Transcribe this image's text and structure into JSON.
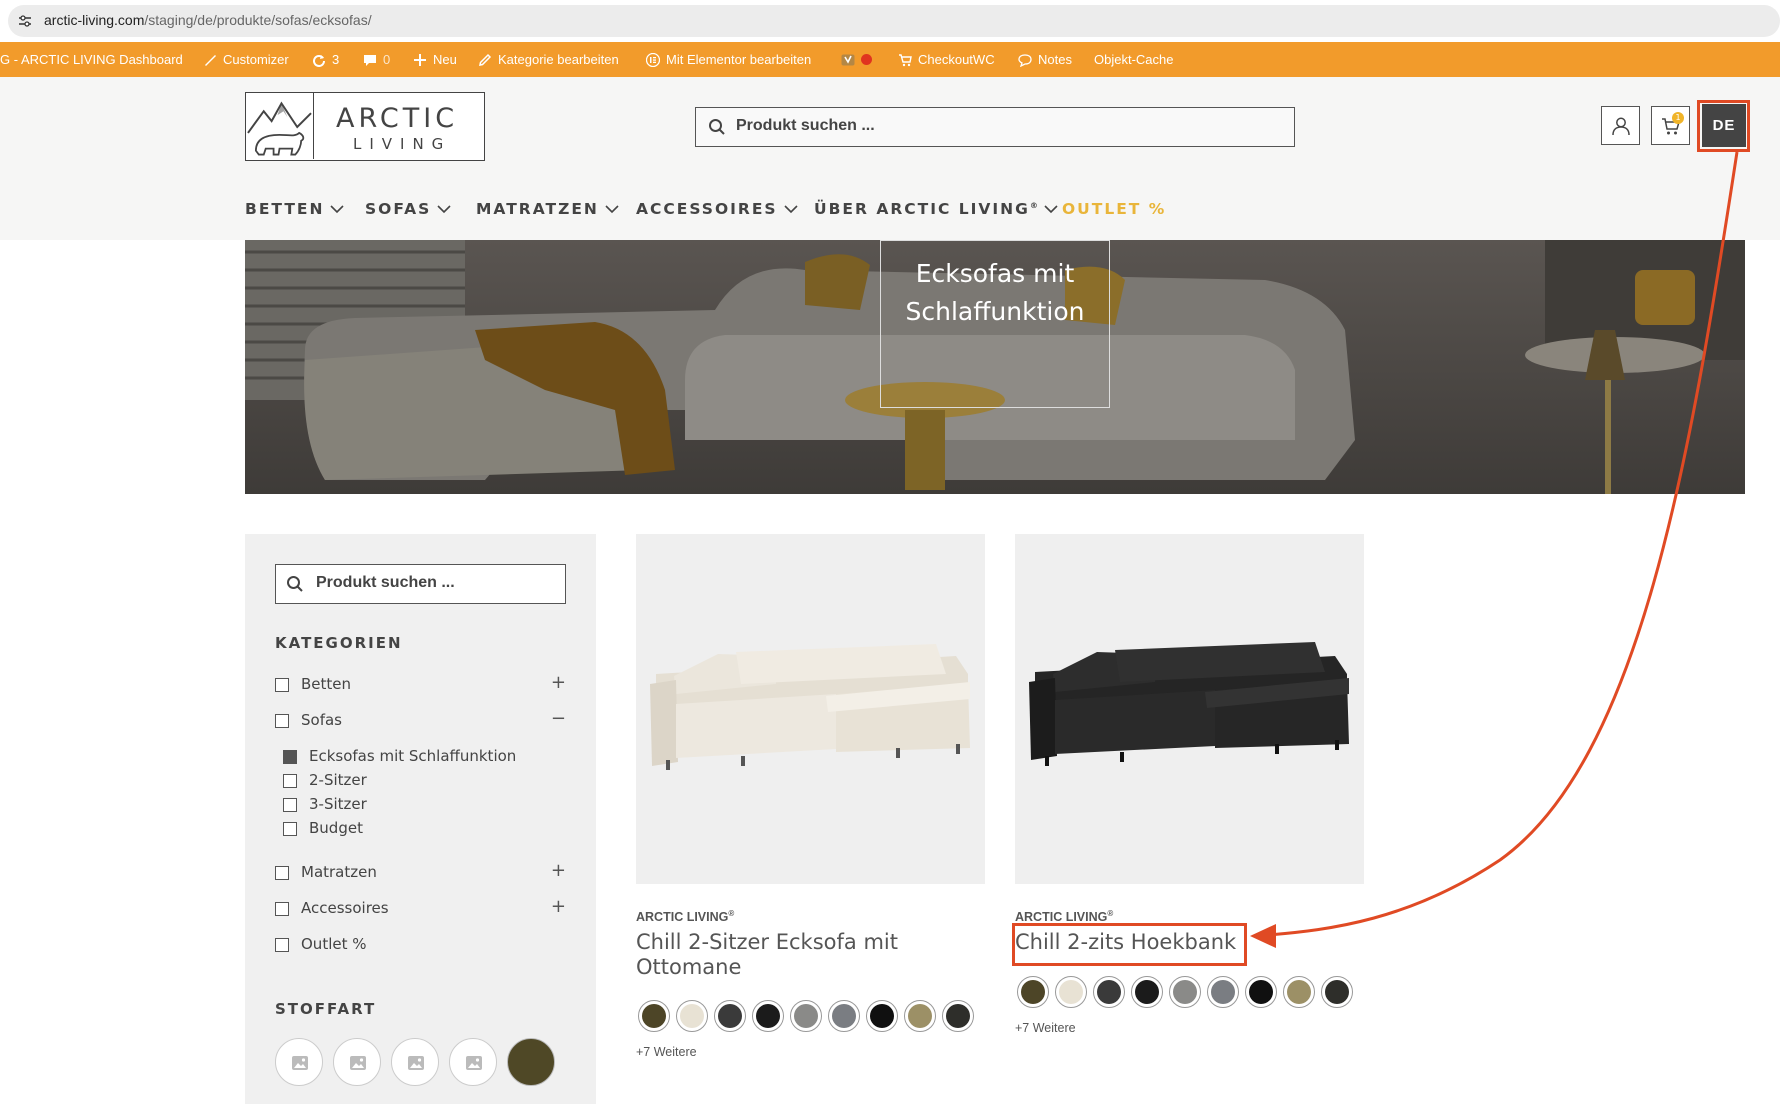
{
  "browser": {
    "url_host": "arctic-living.com",
    "url_path": "/staging/de/produkte/sofas/ecksofas/"
  },
  "adminbar": {
    "dashboard": "G - ARCTIC LIVING Dashboard",
    "customizer": "Customizer",
    "updates": "3",
    "comments": "0",
    "new": "Neu",
    "edit_category": "Kategorie bearbeiten",
    "elementor": "Mit Elementor bearbeiten",
    "checkout": "CheckoutWC",
    "notes": "Notes",
    "cache": "Objekt-Cache"
  },
  "header": {
    "logo_title": "ARCTIC",
    "logo_sub": "LIVING",
    "search_placeholder": "Produkt suchen ...",
    "cart_count": "1",
    "language": "DE"
  },
  "nav": [
    {
      "label": "BETTEN",
      "dropdown": true
    },
    {
      "label": "SOFAS",
      "dropdown": true
    },
    {
      "label": "MATRATZEN",
      "dropdown": true
    },
    {
      "label": "ACCESSOIRES",
      "dropdown": true
    },
    {
      "label": "ÜBER ARCTIC LIVING",
      "sup": "®",
      "dropdown": true
    },
    {
      "label": "OUTLET %",
      "dropdown": false,
      "color": "#e9b53a"
    }
  ],
  "hero": {
    "title_line1": "Ecksofas mit",
    "title_line2": "Schlaffunktion"
  },
  "sidebar": {
    "search_placeholder": "Produkt suchen ...",
    "categories_heading": "KATEGORIEN",
    "categories": [
      {
        "label": "Betten",
        "toggle": "+"
      },
      {
        "label": "Sofas",
        "toggle": "−"
      }
    ],
    "subcategories": [
      {
        "label": "Ecksofas mit Schlaffunktion",
        "checked": true
      },
      {
        "label": "2-Sitzer",
        "checked": false
      },
      {
        "label": "3-Sitzer",
        "checked": false
      },
      {
        "label": "Budget",
        "checked": false
      }
    ],
    "categories_more": [
      {
        "label": "Matratzen",
        "toggle": "+"
      },
      {
        "label": "Accessoires",
        "toggle": "+"
      },
      {
        "label": "Outlet %",
        "toggle": ""
      }
    ],
    "fabric_heading": "STOFFART"
  },
  "products": [
    {
      "brand": "ARCTIC LIVING",
      "brand_sup": "®",
      "title": "Chill 2-Sitzer Ecksofa mit Ottomane",
      "more": "+7 Weitere",
      "swatch_colors": [
        "#4d4527",
        "#e8e2d4",
        "#3a3a3a",
        "#1b1b1b",
        "#8a8a88",
        "#7a7d82",
        "#101010",
        "#9c9066",
        "#2e2e2a"
      ]
    },
    {
      "brand": "ARCTIC LIVING",
      "brand_sup": "®",
      "title": "Chill 2-zits Hoekbank",
      "more": "+7 Weitere",
      "swatch_colors": [
        "#4d4527",
        "#e8e2d4",
        "#3a3a3a",
        "#1b1b1b",
        "#8a8a88",
        "#7a7d82",
        "#101010",
        "#9c9066",
        "#2e2e2a"
      ]
    }
  ],
  "colors": {
    "admin_bar": "#f29b2b",
    "highlight": "#e04a24",
    "outlet": "#e9b53a"
  }
}
